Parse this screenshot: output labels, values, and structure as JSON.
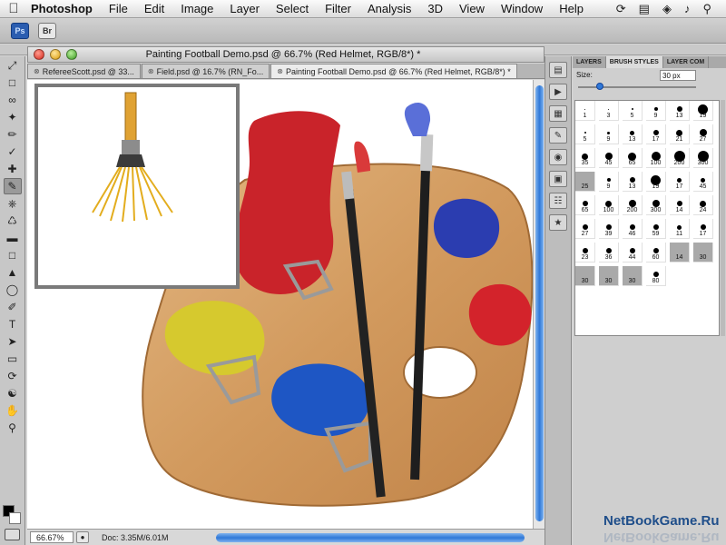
{
  "menubar": {
    "app_name": "Photoshop",
    "items": [
      "File",
      "Edit",
      "Image",
      "Layer",
      "Select",
      "Filter",
      "Analysis",
      "3D",
      "View",
      "Window",
      "Help"
    ]
  },
  "appbar": {
    "ps_label": "Ps",
    "br_label": "Br"
  },
  "document": {
    "window_title": "Painting Football Demo.psd @ 66.7% (Red Helmet, RGB/8*) *",
    "tabs": [
      {
        "label": "RefereeScott.psd @ 33...",
        "active": false
      },
      {
        "label": "Field.psd @ 16.7% (RN_Fo...",
        "active": false
      },
      {
        "label": "Painting Football Demo.psd @ 66.7% (Red Helmet, RGB/8*) *",
        "active": true
      }
    ],
    "zoom": "66.67%",
    "doc_size": "Doc: 3.35M/6.01M"
  },
  "brush_panel": {
    "tabs": [
      "LAYERS",
      "BRUSH STYLES",
      "LAYER COM"
    ],
    "active_tab": "BRUSH STYLES",
    "size_label": "Size:",
    "size_value": "30 px",
    "size_fraction": 0.16,
    "presets": [
      {
        "n": "1",
        "d": 1
      },
      {
        "n": "3",
        "d": 1
      },
      {
        "n": "5",
        "d": 2
      },
      {
        "n": "9",
        "d": 4
      },
      {
        "n": "13",
        "d": 6
      },
      {
        "n": "19",
        "d": 11
      },
      {
        "n": "5",
        "d": 2
      },
      {
        "n": "9",
        "d": 3
      },
      {
        "n": "13",
        "d": 5
      },
      {
        "n": "17",
        "d": 6
      },
      {
        "n": "21",
        "d": 7
      },
      {
        "n": "27",
        "d": 8
      },
      {
        "n": "35",
        "d": 7
      },
      {
        "n": "45",
        "d": 8
      },
      {
        "n": "65",
        "d": 9
      },
      {
        "n": "100",
        "d": 10
      },
      {
        "n": "200",
        "d": 12
      },
      {
        "n": "300",
        "d": 12
      },
      {
        "n": "25",
        "d": 0,
        "selected": true
      },
      {
        "n": "9",
        "d": 4
      },
      {
        "n": "13",
        "d": 6
      },
      {
        "n": "19",
        "d": 11
      },
      {
        "n": "17",
        "d": 5
      },
      {
        "n": "45",
        "d": 5
      },
      {
        "n": "65",
        "d": 6
      },
      {
        "n": "100",
        "d": 7
      },
      {
        "n": "200",
        "d": 8
      },
      {
        "n": "300",
        "d": 8
      },
      {
        "n": "14",
        "d": 6
      },
      {
        "n": "24",
        "d": 7
      },
      {
        "n": "27",
        "d": 6
      },
      {
        "n": "39",
        "d": 6
      },
      {
        "n": "46",
        "d": 6
      },
      {
        "n": "59",
        "d": 6
      },
      {
        "n": "11",
        "d": 5
      },
      {
        "n": "17",
        "d": 6
      },
      {
        "n": "23",
        "d": 6
      },
      {
        "n": "36",
        "d": 6
      },
      {
        "n": "44",
        "d": 6
      },
      {
        "n": "60",
        "d": 6
      },
      {
        "n": "14",
        "d": 0,
        "selected": true
      },
      {
        "n": "30",
        "d": 0,
        "selected": true
      },
      {
        "n": "30",
        "d": 0,
        "selected": true
      },
      {
        "n": "30",
        "d": 0,
        "selected": true
      },
      {
        "n": "30",
        "d": 0,
        "selected": true
      },
      {
        "n": "80",
        "d": 6
      }
    ]
  },
  "tools": [
    "move-tool",
    "marquee-tool",
    "lasso-tool",
    "quick-select-tool",
    "crop-tool",
    "eyedropper-tool",
    "healing-tool",
    "brush-tool",
    "clone-stamp-tool",
    "history-brush-tool",
    "eraser-tool",
    "gradient-tool",
    "blur-tool",
    "dodge-tool",
    "pen-tool",
    "type-tool",
    "path-select-tool",
    "shape-tool",
    "3d-rotate-tool",
    "3d-orbit-tool",
    "hand-tool",
    "zoom-tool"
  ],
  "active_tool": "brush-tool",
  "watermark": "NetBookGame.Ru"
}
